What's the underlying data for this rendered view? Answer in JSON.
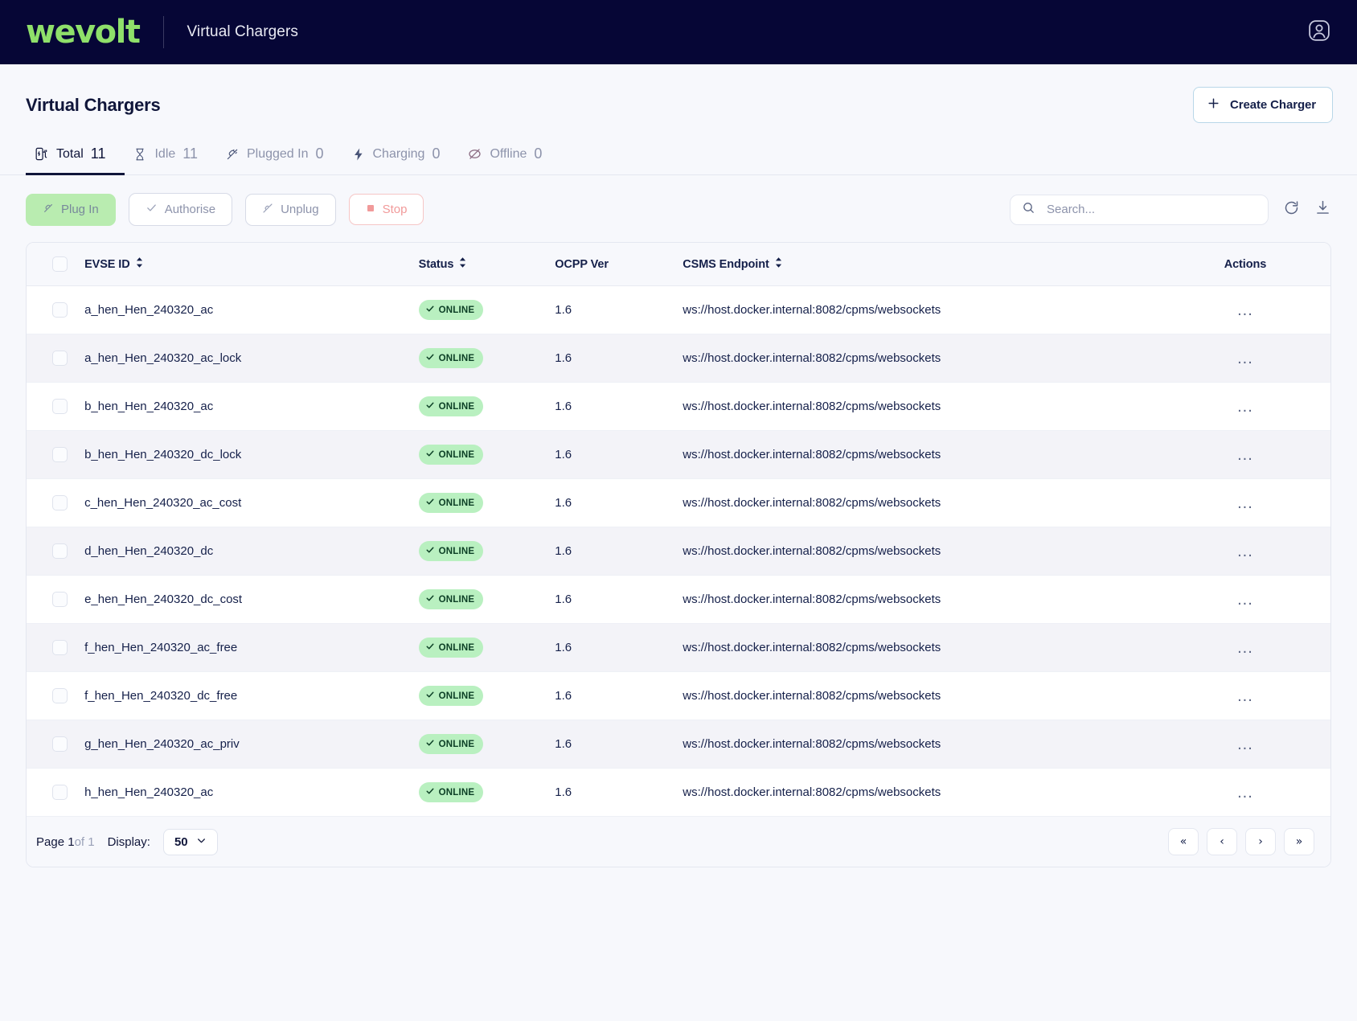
{
  "topbar": {
    "logo_text": "wevolt",
    "title": "Virtual Chargers",
    "avatar_icon": "account-avatar-icon"
  },
  "page": {
    "title": "Virtual Chargers",
    "create_button": {
      "label": "Create Charger",
      "icon": "plus-icon"
    }
  },
  "tabs": [
    {
      "label": "Total",
      "count": "11",
      "icon": "charger-icon",
      "active": true
    },
    {
      "label": "Idle",
      "count": "11",
      "icon": "hourglass-icon",
      "active": false
    },
    {
      "label": "Plugged In",
      "count": "0",
      "icon": "plug-icon",
      "active": false
    },
    {
      "label": "Charging",
      "count": "0",
      "icon": "bolt-icon",
      "active": false
    },
    {
      "label": "Offline",
      "count": "0",
      "icon": "offline-icon",
      "active": false
    }
  ],
  "toolbar": {
    "plug_in_label": "Plug In",
    "authorise_label": "Authorise",
    "unplug_label": "Unplug",
    "stop_label": "Stop",
    "search_placeholder": "Search...",
    "search_value": "",
    "refresh_icon": "refresh-icon",
    "download_icon": "download-icon"
  },
  "table": {
    "columns": [
      {
        "key": "evse",
        "label": "EVSE ID",
        "sortable": true
      },
      {
        "key": "status",
        "label": "Status",
        "sortable": true
      },
      {
        "key": "ocpp",
        "label": "OCPP Ver",
        "sortable": false
      },
      {
        "key": "csms",
        "label": "CSMS Endpoint",
        "sortable": true
      },
      {
        "key": "actions",
        "label": "Actions",
        "sortable": false
      }
    ],
    "rows": [
      {
        "evse": "a_hen_Hen_240320_ac",
        "status": "ONLINE",
        "ocpp": "1.6",
        "csms": "ws://host.docker.internal:8082/cpms/websockets"
      },
      {
        "evse": "a_hen_Hen_240320_ac_lock",
        "status": "ONLINE",
        "ocpp": "1.6",
        "csms": "ws://host.docker.internal:8082/cpms/websockets"
      },
      {
        "evse": "b_hen_Hen_240320_ac",
        "status": "ONLINE",
        "ocpp": "1.6",
        "csms": "ws://host.docker.internal:8082/cpms/websockets"
      },
      {
        "evse": "b_hen_Hen_240320_dc_lock",
        "status": "ONLINE",
        "ocpp": "1.6",
        "csms": "ws://host.docker.internal:8082/cpms/websockets"
      },
      {
        "evse": "c_hen_Hen_240320_ac_cost",
        "status": "ONLINE",
        "ocpp": "1.6",
        "csms": "ws://host.docker.internal:8082/cpms/websockets"
      },
      {
        "evse": "d_hen_Hen_240320_dc",
        "status": "ONLINE",
        "ocpp": "1.6",
        "csms": "ws://host.docker.internal:8082/cpms/websockets"
      },
      {
        "evse": "e_hen_Hen_240320_dc_cost",
        "status": "ONLINE",
        "ocpp": "1.6",
        "csms": "ws://host.docker.internal:8082/cpms/websockets"
      },
      {
        "evse": "f_hen_Hen_240320_ac_free",
        "status": "ONLINE",
        "ocpp": "1.6",
        "csms": "ws://host.docker.internal:8082/cpms/websockets"
      },
      {
        "evse": "f_hen_Hen_240320_dc_free",
        "status": "ONLINE",
        "ocpp": "1.6",
        "csms": "ws://host.docker.internal:8082/cpms/websockets"
      },
      {
        "evse": "g_hen_Hen_240320_ac_priv",
        "status": "ONLINE",
        "ocpp": "1.6",
        "csms": "ws://host.docker.internal:8082/cpms/websockets"
      },
      {
        "evse": "h_hen_Hen_240320_ac",
        "status": "ONLINE",
        "ocpp": "1.6",
        "csms": "ws://host.docker.internal:8082/cpms/websockets"
      }
    ],
    "row_action_label": "..."
  },
  "footer": {
    "page_prefix": "Page",
    "page_current": "1",
    "page_suffix": "of 1",
    "display_label": "Display:",
    "display_value": "50",
    "first_label": "«",
    "prev_label": "‹",
    "next_label": "›",
    "last_label": "»"
  },
  "colors": {
    "brand_green": "#8fe06a",
    "header_navy": "#060636",
    "text_dark": "#10163a",
    "badge_green_bg": "#b9f0c0",
    "stop_red": "#f19a9a"
  }
}
